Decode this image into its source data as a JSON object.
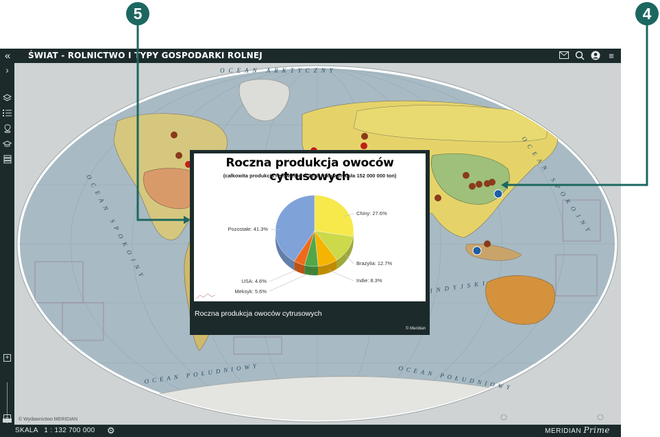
{
  "header": {
    "title": "ŚWIAT - ROLNICTWO I TYPY GOSPODARKI ROLNEJ"
  },
  "callouts": [
    {
      "label": "5"
    },
    {
      "label": "4"
    }
  ],
  "map": {
    "oceans": {
      "arctic": "OCEAN ARKTYCZNY",
      "pacific_left": "OCEAN SPOKOJNY",
      "pacific_right": "OCEAN SPOKOJNY",
      "indian": "OCEAN INDYJSKI",
      "southern": "OCEAN POŁUDNIOWY"
    },
    "copyright": "© Wydawnictwo MERIDIAN"
  },
  "popup": {
    "caption": "Roczna produkcja owoców cytrusowych",
    "copyright": "© Meridian"
  },
  "chart_data": {
    "type": "pie",
    "title": "Roczna produkcja owoców cytrusowych",
    "subtitle": "(całkowita produkcja na świecie w 2018 roku wyniosła 152 000 000 ton)",
    "slices": [
      {
        "label": "Chiny: 27.6%",
        "value": 27.6,
        "color": "#f7e94b"
      },
      {
        "label": "Brazylia: 12.7%",
        "value": 12.7,
        "color": "#cbd94a"
      },
      {
        "label": "Indie: 8.3%",
        "value": 8.3,
        "color": "#f5b400"
      },
      {
        "label": "Meksyk: 5.6%",
        "value": 5.6,
        "color": "#52a848"
      },
      {
        "label": "USA: 4.6%",
        "value": 4.6,
        "color": "#ef6a1b"
      },
      {
        "label": "Pozostałe: 41.3%",
        "value": 41.3,
        "color": "#7fa2d9"
      }
    ]
  },
  "footer": {
    "scale": "SKALA   1 : 132 700 000",
    "brand": "MERIDIAN",
    "brand_suffix": "Prime"
  }
}
